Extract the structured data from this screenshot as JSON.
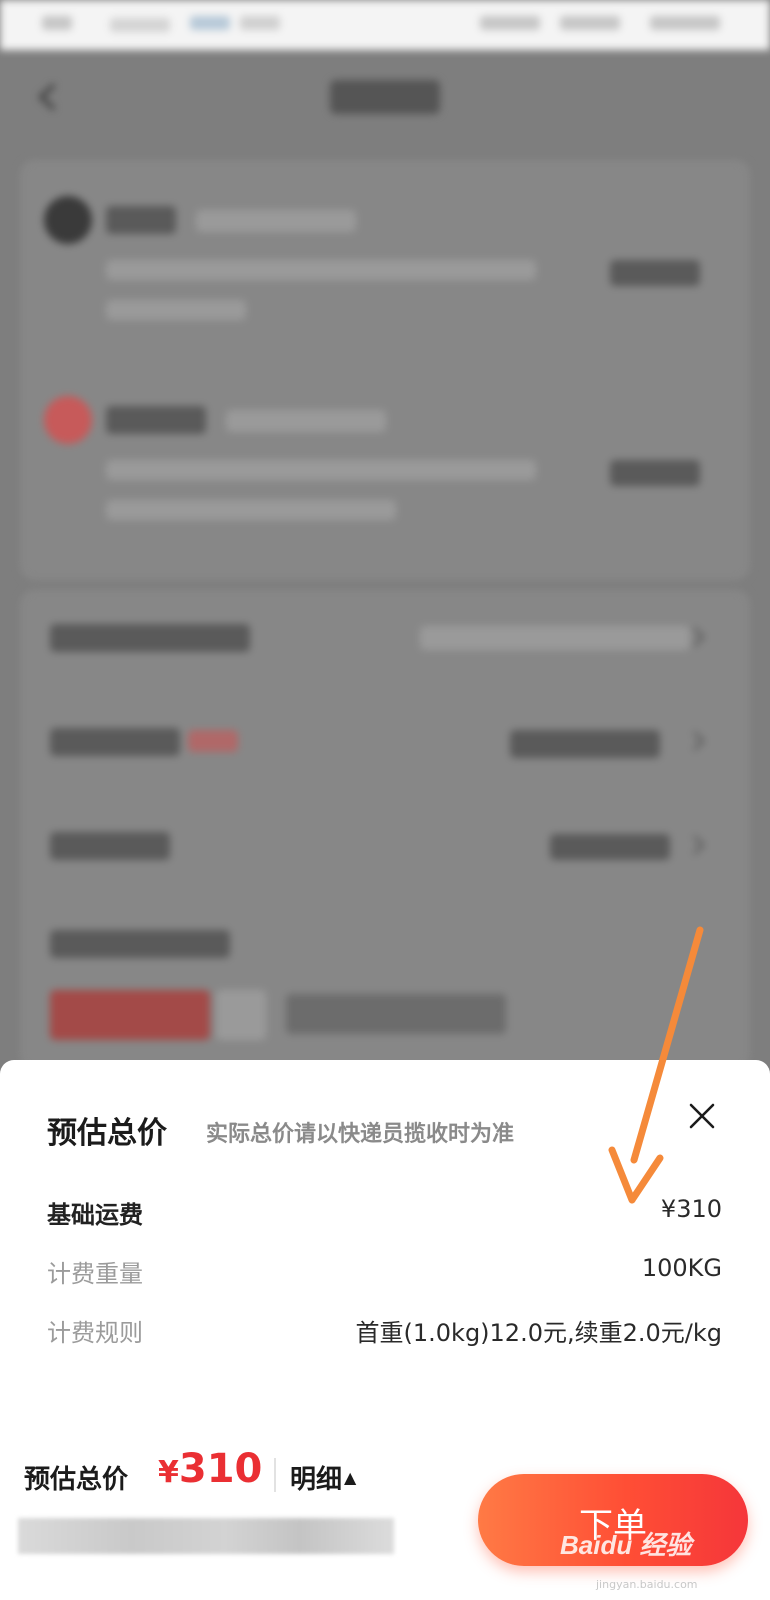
{
  "sheet": {
    "title": "预估总价",
    "subtitle": "实际总价请以快递员揽收时为准",
    "rows": [
      {
        "label": "基础运费",
        "value": "¥310"
      },
      {
        "label": "计费重量",
        "value": "100KG"
      },
      {
        "label": "计费规则",
        "value": "首重(1.0kg)12.0元,续重2.0元/kg"
      }
    ]
  },
  "footer": {
    "total_label": "预估总价",
    "currency": "¥",
    "total_amount": "310",
    "detail_label": "明细",
    "detail_arrow": "▲",
    "order_button": "下单"
  },
  "watermark": {
    "brand": "Bai",
    "brand2": "du",
    "suffix": "经验",
    "url": "jingyan.baidu.com"
  },
  "colors": {
    "price_red": "#ea2f33",
    "button_start": "#ff7a45",
    "button_end": "#f5363a",
    "annotation_arrow": "#f58a3a",
    "overlay": "#7e7e7e"
  },
  "icons": {
    "close": "close-icon",
    "back": "back-arrow-icon",
    "annotation": "annotation-arrow-icon"
  }
}
